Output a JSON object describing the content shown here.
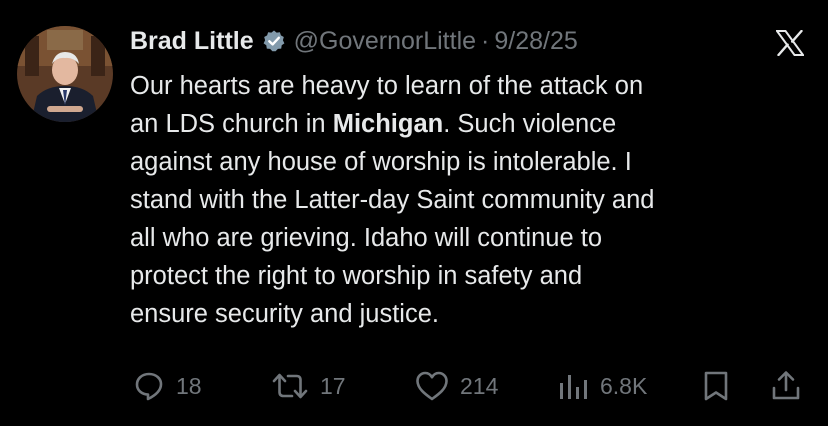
{
  "tweet": {
    "display_name": "Brad Little",
    "handle": "@GovernorLittle",
    "separator": "·",
    "date": "9/28/25",
    "text_line_1": "Our hearts are heavy to learn of the attack on",
    "text_line_2_before": "an LDS church in ",
    "text_line_2_bold": "Michigan",
    "text_line_2_after": ". Such violence",
    "text_line_3": "against any house of worship is intolerable. I",
    "text_line_4": "stand with the Latter-day Saint community and",
    "text_line_5": "all who are grieving. Idaho will continue to",
    "text_line_6": "protect the right to worship in safety and",
    "text_line_7": "ensure security and justice."
  },
  "actions": {
    "replies": "18",
    "reposts": "17",
    "likes": "214",
    "views": "6.8K"
  },
  "icons": {
    "verified": "verified-badge-icon",
    "logo": "x-logo-icon",
    "reply": "reply-icon",
    "repost": "repost-icon",
    "like": "heart-icon",
    "views": "views-chart-icon",
    "bookmark": "bookmark-icon",
    "share": "share-icon"
  },
  "colors": {
    "background": "#000000",
    "text": "#e7e9ea",
    "muted": "#71767b"
  }
}
